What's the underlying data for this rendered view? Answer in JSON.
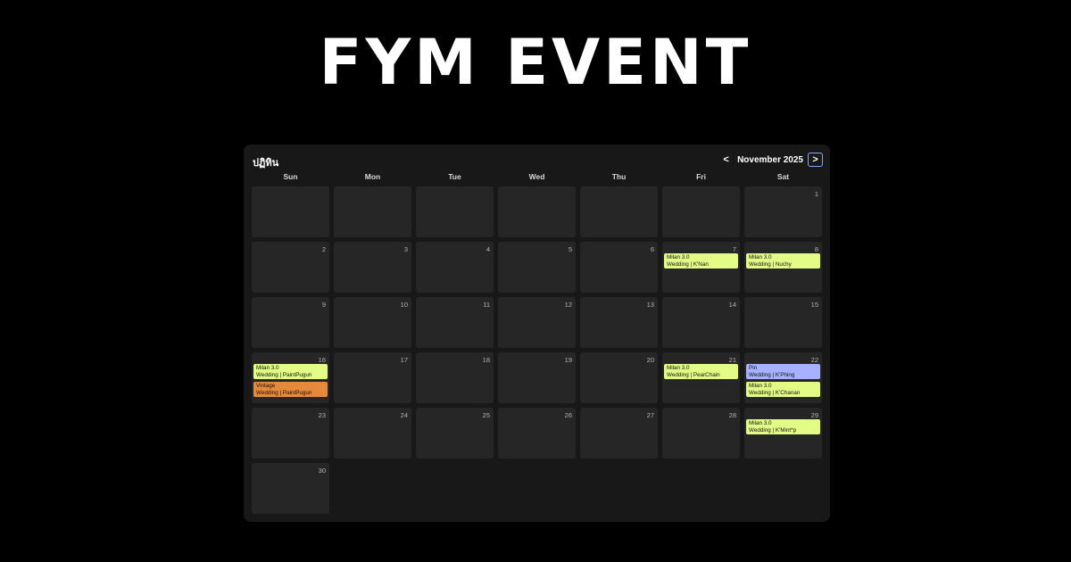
{
  "header": {
    "title": "FYM EVENT"
  },
  "calendar": {
    "title": "ปฏิทิน",
    "month_label": "November 2025",
    "prev_label": "<",
    "next_label": ">",
    "weekdays": [
      "Sun",
      "Mon",
      "Tue",
      "Wed",
      "Thu",
      "Fri",
      "Sat"
    ],
    "leading_blank_days": 6,
    "days": [
      {
        "day": "1",
        "events": []
      },
      {
        "day": "2",
        "events": []
      },
      {
        "day": "3",
        "events": []
      },
      {
        "day": "4",
        "events": []
      },
      {
        "day": "5",
        "events": []
      },
      {
        "day": "6",
        "events": []
      },
      {
        "day": "7",
        "events": [
          {
            "line1": "Milan 3.0",
            "line2": "Wedding | K'Nan",
            "color": "#e2fc85"
          }
        ]
      },
      {
        "day": "8",
        "events": [
          {
            "line1": "Milan 3.0",
            "line2": "Wedding | Nuchy",
            "color": "#e2fc85"
          }
        ]
      },
      {
        "day": "9",
        "events": []
      },
      {
        "day": "10",
        "events": []
      },
      {
        "day": "11",
        "events": []
      },
      {
        "day": "12",
        "events": []
      },
      {
        "day": "13",
        "events": []
      },
      {
        "day": "14",
        "events": []
      },
      {
        "day": "15",
        "events": []
      },
      {
        "day": "16",
        "events": [
          {
            "line1": "Milan 3.0",
            "line2": "Wedding | PaintPugun",
            "color": "#e2fc85"
          },
          {
            "line1": "Vintage",
            "line2": "Wedding | PaintPugun",
            "color": "#e58a3a"
          }
        ]
      },
      {
        "day": "17",
        "events": []
      },
      {
        "day": "18",
        "events": []
      },
      {
        "day": "19",
        "events": []
      },
      {
        "day": "20",
        "events": []
      },
      {
        "day": "21",
        "events": [
          {
            "line1": "Milan 3.0",
            "line2": "Wedding | PearChain",
            "color": "#e2fc85"
          }
        ]
      },
      {
        "day": "22",
        "events": [
          {
            "line1": "Pin",
            "line2": "Wedding | K'Phing",
            "color": "#a6b1ff"
          },
          {
            "line1": "Milan 3.0",
            "line2": "Wedding | K'Chanan",
            "color": "#e2fc85"
          }
        ]
      },
      {
        "day": "23",
        "events": []
      },
      {
        "day": "24",
        "events": []
      },
      {
        "day": "25",
        "events": []
      },
      {
        "day": "26",
        "events": []
      },
      {
        "day": "27",
        "events": []
      },
      {
        "day": "28",
        "events": []
      },
      {
        "day": "29",
        "events": [
          {
            "line1": "Milan 3.0",
            "line2": "Wedding | K'Mint*p",
            "color": "#e2fc85"
          }
        ]
      },
      {
        "day": "30",
        "events": []
      }
    ]
  },
  "colors": {
    "page_background": "#000000",
    "calendar_background": "#181818",
    "cell_background": "#262626",
    "focus_ring": "#8ea3ff"
  }
}
